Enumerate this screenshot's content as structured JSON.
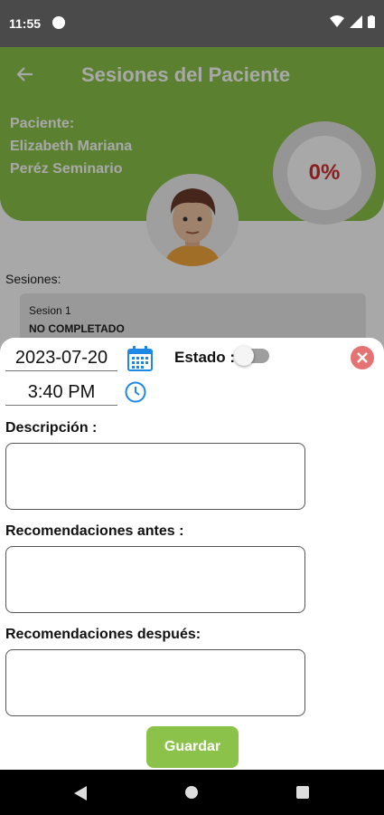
{
  "status_bar": {
    "time": "11:55"
  },
  "header": {
    "title": "Sesiones del Paciente",
    "patient_label": "Paciente:",
    "patient_name_line1": "Elizabeth Mariana",
    "patient_name_line2": "Peréz Seminario",
    "progress_text": "0%",
    "progress_fraction": 0,
    "brand_color": "#8bc34a",
    "progress_color": "#d32f2f"
  },
  "sessions": {
    "label": "Sesiones:",
    "items": [
      {
        "title": "Sesion 1",
        "status": "NO COMPLETADO"
      }
    ]
  },
  "form": {
    "date": "2023-07-20",
    "time": "3:40 PM",
    "estado_label": "Estado :",
    "estado_on": false,
    "descripcion_label": "Descripción :",
    "descripcion_value": "",
    "recomendaciones_antes_label": "Recomendaciones antes :",
    "recomendaciones_antes_value": "",
    "recomendaciones_despues_label": "Recomendaciones después:",
    "recomendaciones_despues_value": "",
    "save_label": "Guardar",
    "icons": [
      "calendar-icon",
      "clock-icon",
      "close-icon"
    ]
  }
}
